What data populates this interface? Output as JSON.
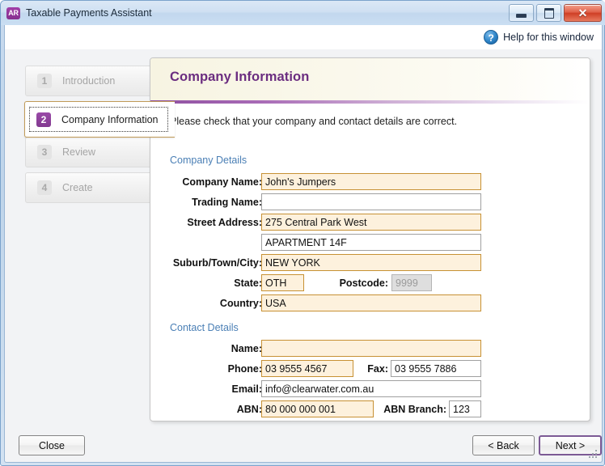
{
  "window": {
    "app_icon_text": "AR",
    "title": "Taxable Payments Assistant",
    "minimize_label": "Minimize",
    "maximize_label": "Maximize",
    "close_label": "Close"
  },
  "helpbar": {
    "icon": "question-mark-icon",
    "link_label": "Help for this window"
  },
  "sidebar": {
    "items": [
      {
        "number": "1",
        "label": "Introduction"
      },
      {
        "number": "2",
        "label": "Company Information"
      },
      {
        "number": "3",
        "label": "Review"
      },
      {
        "number": "4",
        "label": "Create"
      }
    ]
  },
  "panel": {
    "title": "Company Information",
    "intro": "Please check that your company and contact details are correct.",
    "sections": [
      {
        "title": "Company Details"
      },
      {
        "title": "Contact Details"
      }
    ],
    "fields": {
      "company_name": {
        "label": "Company Name:",
        "value": "John's Jumpers"
      },
      "trading_name": {
        "label": "Trading Name:",
        "value": ""
      },
      "street_address": {
        "label": "Street Address:",
        "value": "275 Central Park West"
      },
      "street_address2": {
        "label": "",
        "value": "APARTMENT 14F"
      },
      "suburb": {
        "label": "Suburb/Town/City:",
        "value": "NEW YORK"
      },
      "state": {
        "label": "State:",
        "value": "OTH"
      },
      "postcode": {
        "label": "Postcode:",
        "value": "9999"
      },
      "country": {
        "label": "Country:",
        "value": "USA"
      },
      "contact_name": {
        "label": "Name:",
        "value": ""
      },
      "phone": {
        "label": "Phone:",
        "value": "03 9555 4567"
      },
      "fax": {
        "label": "Fax:",
        "value": "03 9555 7886"
      },
      "email": {
        "label": "Email:",
        "value": "info@clearwater.com.au"
      },
      "abn": {
        "label": "ABN:",
        "value": "80 000 000 001"
      },
      "abn_branch": {
        "label": "ABN Branch:",
        "value": "123"
      }
    }
  },
  "footer": {
    "close_label": "Close",
    "back_label": "< Back",
    "next_label": "Next >"
  },
  "colors": {
    "accent_purple": "#6b2d80",
    "step_badge_active": "#8f3f9d",
    "field_highlight_border": "#c79134",
    "field_highlight_bg": "#fdf1dd",
    "section_heading": "#4a7fb5",
    "close_button_red": "#cf3f26"
  }
}
